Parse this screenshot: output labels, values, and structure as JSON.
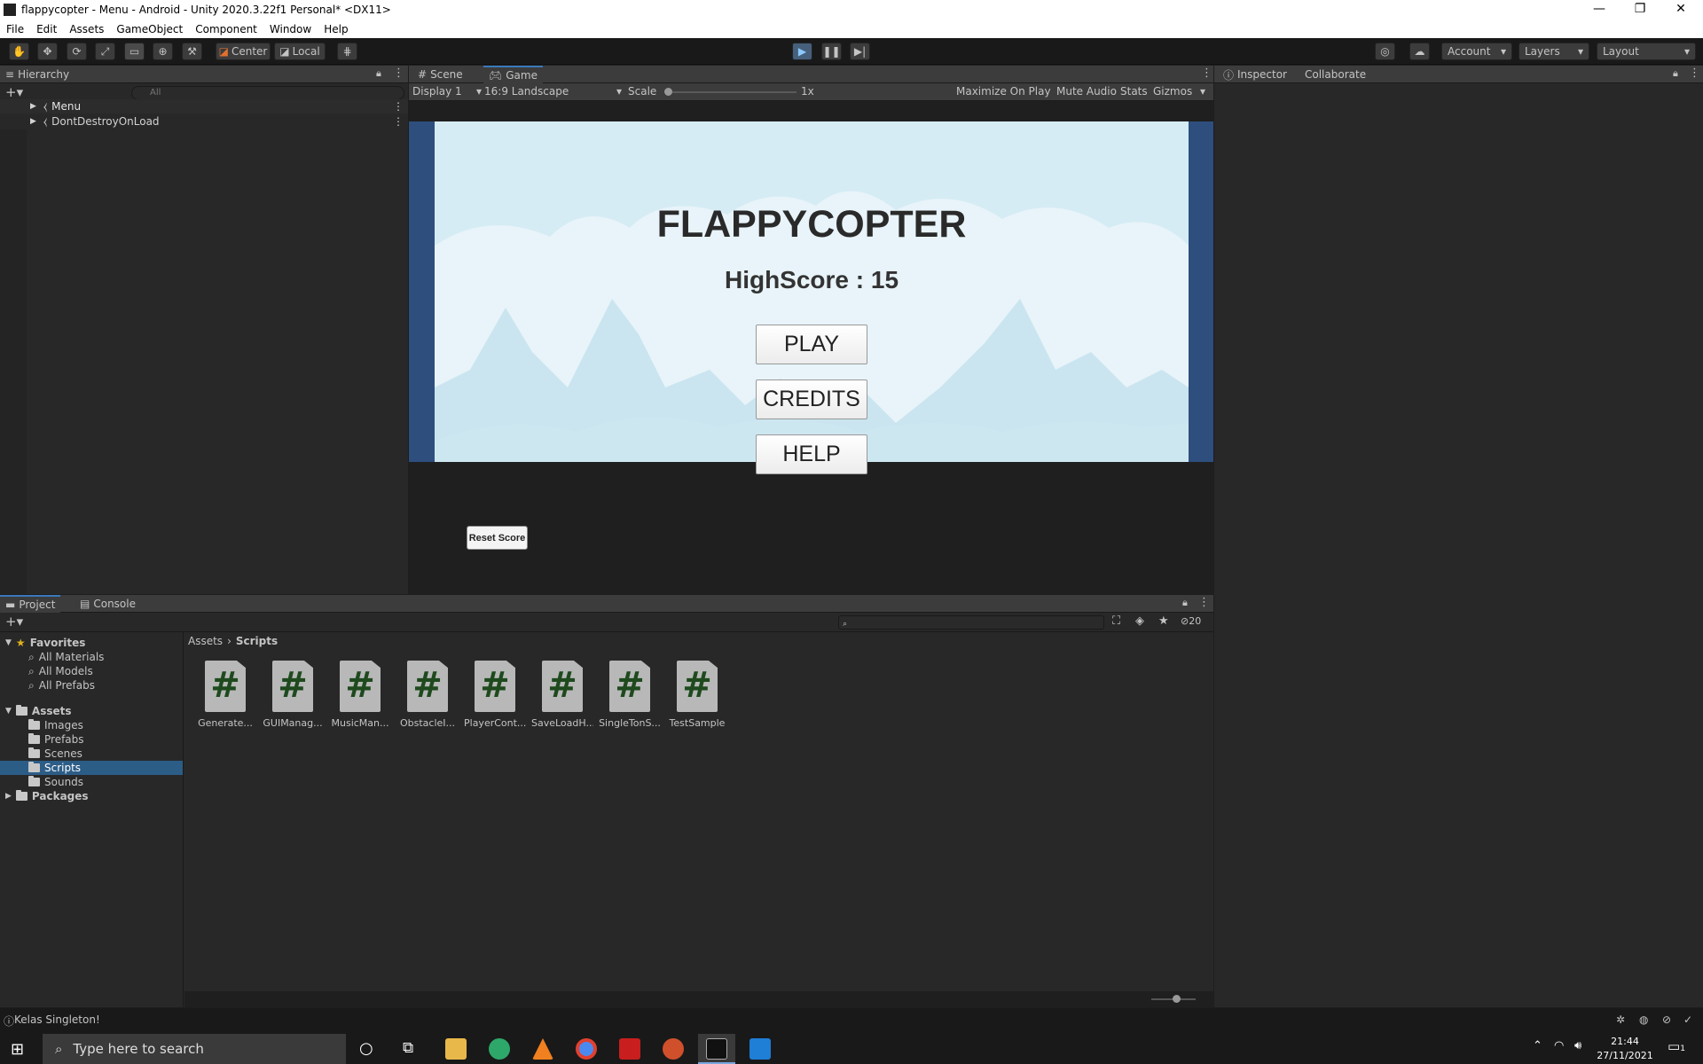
{
  "window": {
    "title": "flappycopter - Menu - Android - Unity 2020.3.22f1 Personal* <DX11>"
  },
  "menubar": [
    "File",
    "Edit",
    "Assets",
    "GameObject",
    "Component",
    "Window",
    "Help"
  ],
  "toolbar": {
    "pivot": "Center",
    "space": "Local",
    "account": "Account",
    "layers": "Layers",
    "layout": "Layout"
  },
  "hierarchy": {
    "tab": "Hierarchy",
    "search_placeholder": "All",
    "items": [
      "Menu",
      "DontDestroyOnLoad"
    ]
  },
  "center_tabs": {
    "scene": "Scene",
    "game": "Game"
  },
  "game_toolbar": {
    "display": "Display 1",
    "aspect": "16:9 Landscape",
    "scale_label": "Scale",
    "scale_value": "1x",
    "maximize": "Maximize On Play",
    "mute": "Mute Audio",
    "stats": "Stats",
    "gizmos": "Gizmos"
  },
  "game_view": {
    "title": "FLAPPYCOPTER",
    "highscore": "HighScore : 15",
    "play": "PLAY",
    "credits": "CREDITS",
    "help": "HELP",
    "reset": "Reset Score",
    "bg_sky": "#d6ecf5",
    "bg_side": "#2e4e7e"
  },
  "inspector": {
    "tab": "Inspector",
    "collaborate": "Collaborate"
  },
  "bottom_tabs": {
    "project": "Project",
    "console": "Console",
    "hidden_count": "20"
  },
  "project_tree": {
    "favorites": {
      "label": "Favorites",
      "items": [
        "All Materials",
        "All Models",
        "All Prefabs"
      ]
    },
    "assets": {
      "label": "Assets",
      "items": [
        "Images",
        "Prefabs",
        "Scenes",
        "Scripts",
        "Sounds"
      ],
      "selected": "Scripts"
    },
    "packages": "Packages"
  },
  "breadcrumb": {
    "root": "Assets",
    "current": "Scripts"
  },
  "scripts": [
    "Generate...",
    "GUIManag...",
    "MusicMan...",
    "ObstacleI...",
    "PlayerCont...",
    "SaveLoadH...",
    "SingleTonS...",
    "TestSample"
  ],
  "status": {
    "message": "Kelas Singleton!"
  },
  "taskbar": {
    "search_placeholder": "Type here to search",
    "time": "21:44",
    "date": "27/11/2021",
    "notification_count": "1"
  }
}
